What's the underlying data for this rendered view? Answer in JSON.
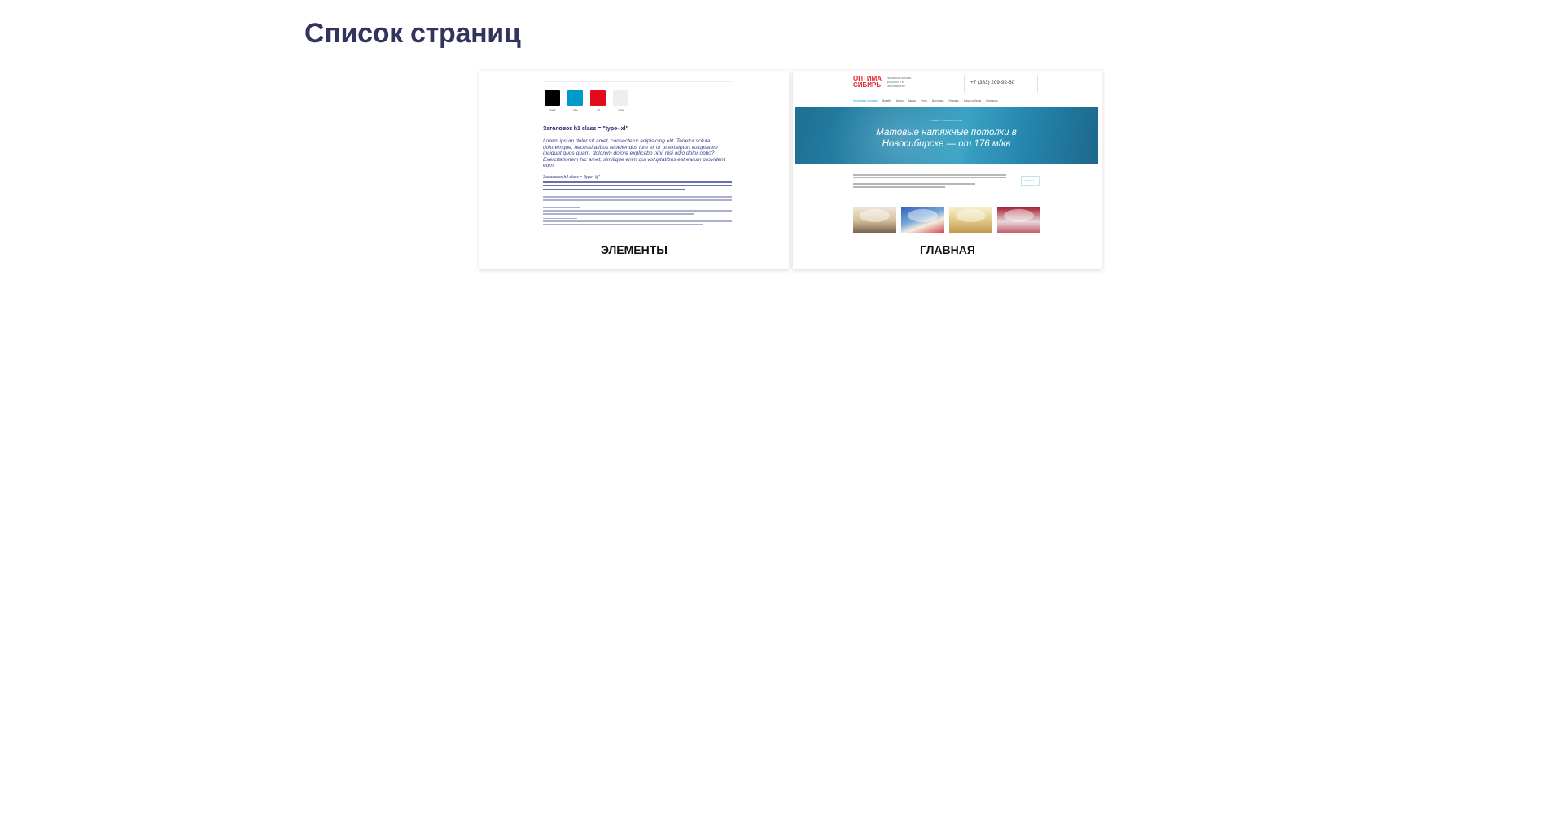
{
  "page": {
    "title": "Список страниц"
  },
  "cards": [
    {
      "label": "ЭЛЕМЕНТЫ",
      "preview": {
        "swatches": [
          {
            "color": "#000000",
            "name": "black"
          },
          {
            "color": "#0099cc",
            "name": "blue"
          },
          {
            "color": "#e30a1b",
            "name": "red"
          },
          {
            "color": "#eeeeee",
            "name": "white"
          }
        ],
        "h1": "Заголовок h1 class = \"type--xl\"",
        "lead": "Lorem ipsum dolor sit amet, consectetur adipisicing elit. Tenetur soluta doloremque, necessitatibus repellendus iure error ut excepturi voluptatem incidunt quos quam, dolorem dolore explicabo nihil nisi odio dolor optio? Exercitationem hic amet, similique enim qui voluptatibus est earum provident eum.",
        "h2": "Заголовок h2 class = \"type--lg\""
      }
    },
    {
      "label": "ГЛАВНАЯ",
      "preview": {
        "logo": "ОПТИМА\nСИБИРЬ",
        "tagline": "Натяжные потолки\nдоступно и в\nкачественном",
        "phone": "+7 (383) 209-92-60",
        "nav": [
          "Натяжные потолки",
          "Дизайн",
          "Цены",
          "Акции",
          "Фото",
          "Доставка",
          "Отзывы",
          "Наши работы",
          "Контакты"
        ],
        "banner_crumbs": "Главная — Натяжные потолки",
        "banner_title": "Матовые натяжные потолки в\nНовосибирске — от 176 м/кв",
        "button": "Подробнее"
      }
    }
  ]
}
